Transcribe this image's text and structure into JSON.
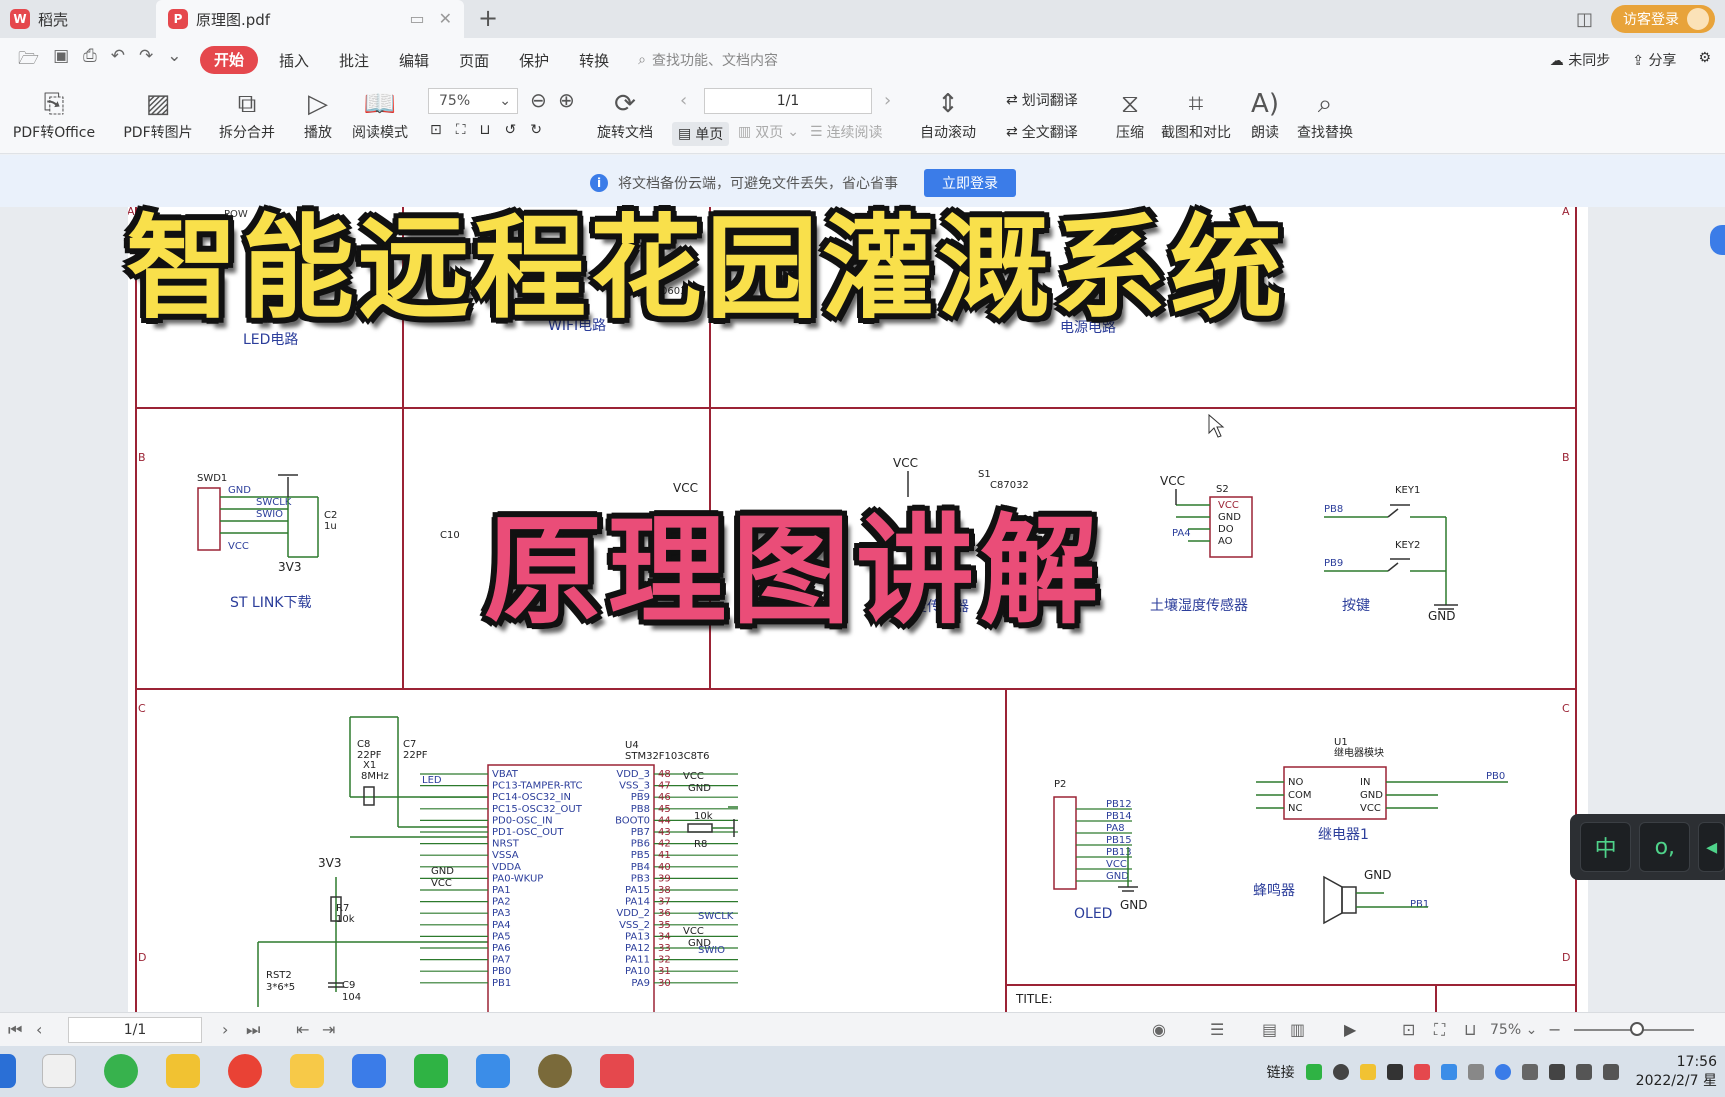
{
  "tabs": {
    "home": "稻壳",
    "doc": "原理图.pdf",
    "visitor_login": "访客登录"
  },
  "menu": {
    "items": [
      "开始",
      "插入",
      "批注",
      "编辑",
      "页面",
      "保护",
      "转换"
    ],
    "search_placeholder": "查找功能、文档内容",
    "sync": "未同步",
    "share": "分享"
  },
  "toolbar": {
    "pdf_to_office": "PDF转Office",
    "pdf_to_image": "PDF转图片",
    "split_merge": "拆分合并",
    "play": "播放",
    "read_mode": "阅读模式",
    "zoom": "75%",
    "rotate_doc": "旋转文档",
    "page_box": "1/1",
    "single_page": "单页",
    "double_page": "双页",
    "continuous": "连续阅读",
    "auto_scroll": "自动滚动",
    "word_translate": "划词翻译",
    "full_translate": "全文翻译",
    "compress": "压缩",
    "screenshot_compare": "截图和对比",
    "read_aloud": "朗读",
    "find_replace": "查找替换"
  },
  "notice": {
    "text": "将文档备份云端，可避免文件丢失，省心省事",
    "login_button": "立即登录"
  },
  "overlay": {
    "title": "智能远程花园灌溉系统",
    "subtitle": "原理图讲解"
  },
  "schematic": {
    "sections": {
      "led": "LED电路",
      "wifi": "WIFI电路",
      "power": "电源电路",
      "stlink": "ST LINK下载",
      "soil_sensor": "土壤湿度传感器",
      "humidity": "温湿度传感器",
      "keys": "按键",
      "oled": "OLED",
      "relay": "继电器1",
      "buzzer": "蜂鸣器"
    },
    "row_labels": [
      "A",
      "B",
      "C",
      "D"
    ],
    "mcu_ref": "U4",
    "mcu_part": "STM32F103C8T6",
    "mcu_left_pins": [
      "VBAT",
      "PC13-TAMPER-RTC",
      "PC14-OSC32_IN",
      "PC15-OSC32_OUT",
      "PD0-OSC_IN",
      "PD1-OSC_OUT",
      "NRST",
      "VSSA",
      "VDDA",
      "PA0-WKUP",
      "PA1",
      "PA2",
      "PA3",
      "PA4",
      "PA5",
      "PA6",
      "PA7",
      "PB0",
      "PB1"
    ],
    "mcu_right_pins": [
      "VDD_3",
      "VSS_3",
      "PB9",
      "PB8",
      "BOOT0",
      "PB7",
      "PB6",
      "PB5",
      "PB4",
      "PB3",
      "PA15",
      "PA14",
      "VDD_2",
      "VSS_2",
      "PA13",
      "PA12",
      "PA11",
      "PA10",
      "PA9"
    ],
    "mcu_right_nums": [
      "48",
      "47",
      "46",
      "45",
      "44",
      "43",
      "42",
      "41",
      "40",
      "39",
      "38",
      "37",
      "36",
      "35",
      "34",
      "33",
      "32",
      "31",
      "30"
    ],
    "swd_label": "SWD1",
    "swd_pins": [
      "GND",
      "SWCLK",
      "SWIO",
      "VCC"
    ],
    "cap_c2": "C2",
    "cap_c2_val": "1u",
    "v3v3": "3V3",
    "vcc": "VCC",
    "gnd": "GND",
    "c8": "C8",
    "c7": "C7",
    "pf22": "22PF",
    "x1": "X1",
    "mhz8": "8MHz",
    "led_net": "LED",
    "r7": "R7",
    "r7_val": "10k",
    "c9": "C9",
    "c9_val": "104",
    "rst": "RST2",
    "rst_size": "3*6*5",
    "r8": "R8",
    "r8_val": "10k",
    "swclk": "SWCLK",
    "swio": "SWIO",
    "p2": "P2",
    "oled_nets": [
      "PB12",
      "PB14",
      "PA8",
      "PB15",
      "PB13",
      "VCC",
      "GND"
    ],
    "key1": "KEY1",
    "key2": "KEY2",
    "pb8": "PB8",
    "pb9": "PB9",
    "s2": "S2",
    "s2_pins": [
      "VCC",
      "GND",
      "DO",
      "AO"
    ],
    "pa4": "PA4",
    "s1": "S1",
    "s1_part": "C87032",
    "u1": "U1",
    "u1_name": "继电器模块",
    "relay_pins": [
      "NO",
      "COM",
      "NC"
    ],
    "relay_right": [
      "IN",
      "GND",
      "VCC"
    ],
    "pb0": "PB0",
    "pb1": "PB1",
    "c10": "C10",
    "title_label": "TITLE:",
    "led_frag_pow": "POW",
    "led_frag_nums": [
      "0603",
      "0603"
    ]
  },
  "statusbar": {
    "page": "1/1",
    "zoom": "75%"
  },
  "taskbar": {
    "tray_link": "链接",
    "time": "17:56",
    "date": "2022/2/7 星"
  }
}
